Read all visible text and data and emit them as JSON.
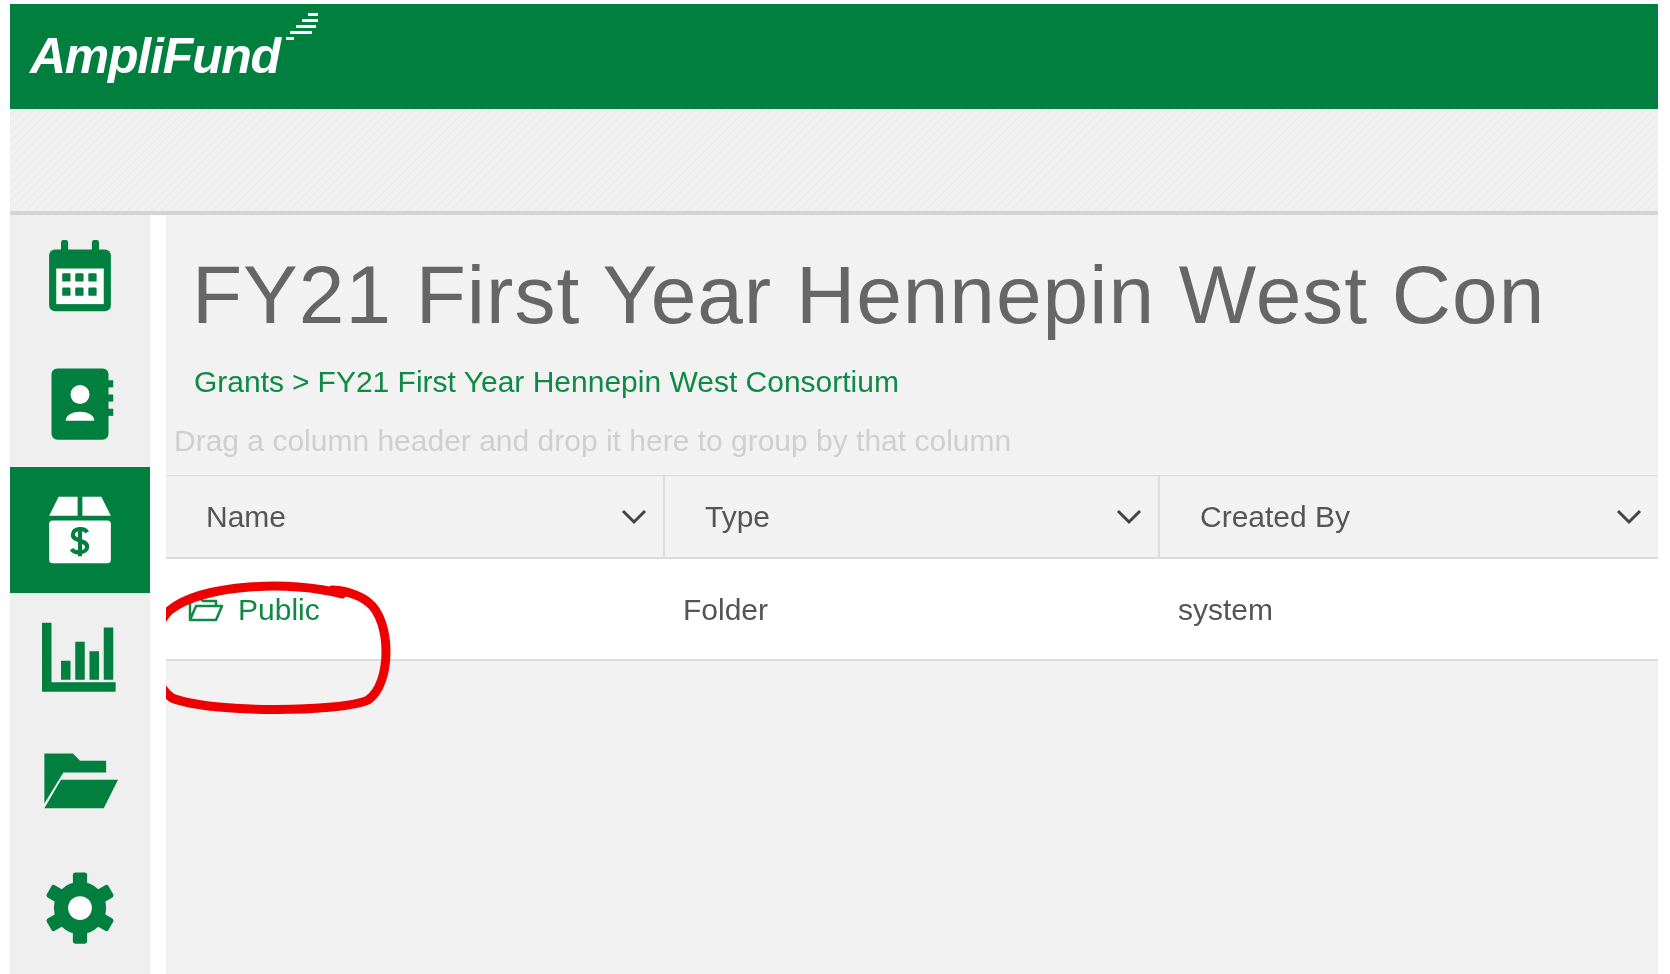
{
  "header": {
    "logo": "AmpliFund"
  },
  "sidebar": {
    "items": [
      {
        "kind": "calendar",
        "selected": false
      },
      {
        "kind": "contacts",
        "selected": false
      },
      {
        "kind": "grants",
        "selected": true
      },
      {
        "kind": "reports",
        "selected": false
      },
      {
        "kind": "files",
        "selected": false
      },
      {
        "kind": "settings",
        "selected": false
      }
    ]
  },
  "page": {
    "title": "FY21 First Year Hennepin West Con",
    "breadcrumb": [
      {
        "label": "Grants"
      },
      {
        "label": "FY21 First Year Hennepin West Consortium"
      }
    ],
    "breadcrumb_separator": ">"
  },
  "grid": {
    "group_hint": "Drag a column header and drop it here to group by that column",
    "columns": [
      "Name",
      "Type",
      "Created By"
    ],
    "rows": [
      {
        "name": "Public",
        "type": "Folder",
        "created_by": "system",
        "highlighted": true
      }
    ]
  }
}
